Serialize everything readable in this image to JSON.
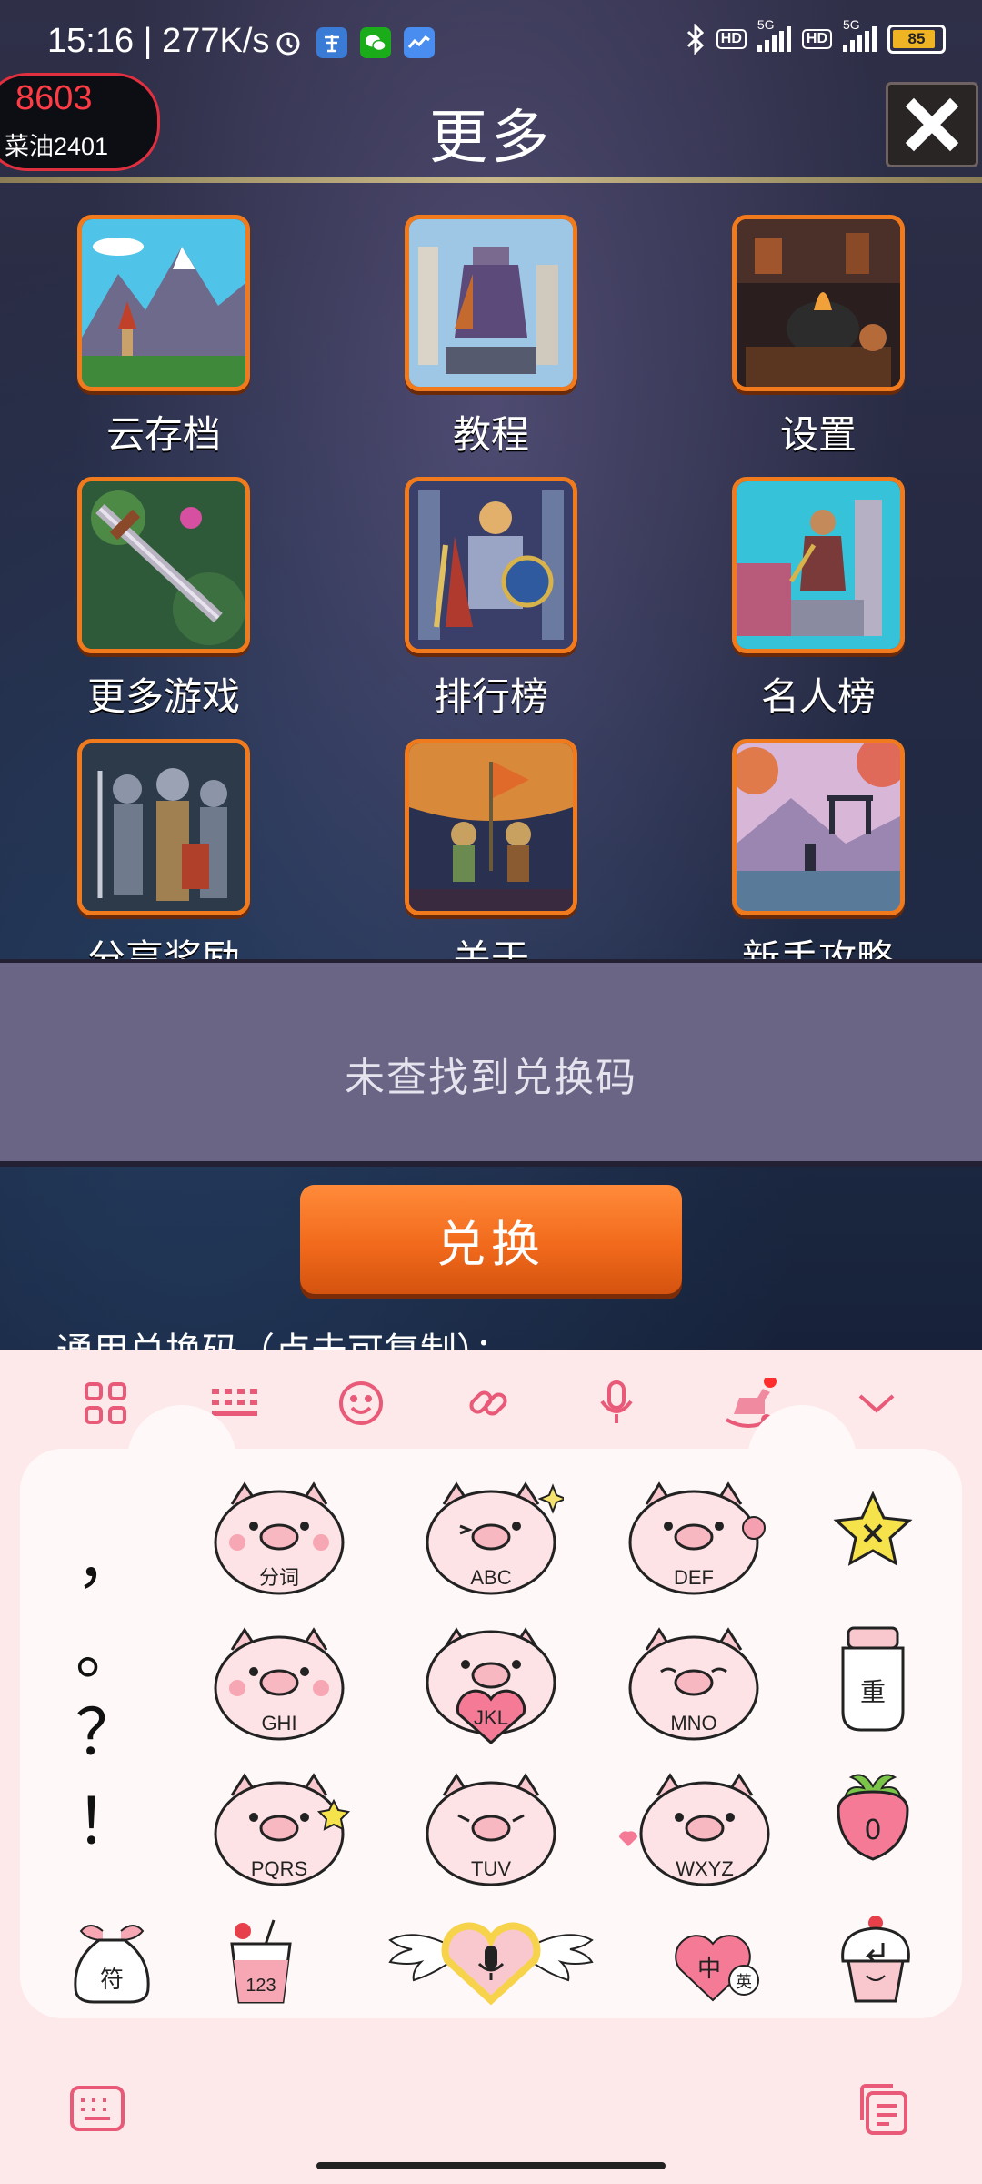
{
  "status_bar": {
    "time_speed": "15:16 | 277K/s",
    "network_1": "5G",
    "network_2": "5G",
    "hd_1": "HD",
    "hd_2": "HD",
    "battery": "85"
  },
  "header": {
    "score": "8603",
    "player_name": "菜油2401",
    "title": "更多"
  },
  "menu": {
    "items": [
      {
        "label": "云存档",
        "icon": "cloud-save-icon"
      },
      {
        "label": "教程",
        "icon": "tutorial-icon"
      },
      {
        "label": "设置",
        "icon": "settings-icon"
      },
      {
        "label": "更多游戏",
        "icon": "more-games-icon"
      },
      {
        "label": "排行榜",
        "icon": "leaderboard-icon"
      },
      {
        "label": "名人榜",
        "icon": "hall-of-fame-icon"
      },
      {
        "label": "分享奖励",
        "icon": "share-reward-icon"
      },
      {
        "label": "关于",
        "icon": "about-icon"
      },
      {
        "label": "新手攻略",
        "icon": "beginner-guide-icon"
      }
    ]
  },
  "redeem": {
    "message": "未查找到兑换码",
    "button": "兑换",
    "generic_code_label": "通用兑换码（点击可复制）："
  },
  "keyboard": {
    "punct_1": "，",
    "punct_2": "。",
    "punct_3": "？",
    "punct_4": "！",
    "keys": {
      "k1": "分词",
      "k2": "ABC",
      "k3": "DEF",
      "k4": "GHI",
      "k5": "JKL",
      "k6": "MNO",
      "k7": "PQRS",
      "k8": "TUV",
      "k9": "WXYZ"
    },
    "reset_key": "重",
    "zero_key": "0",
    "symbol_key": "符",
    "num_key": "123",
    "zh_key": "中",
    "en_key": "英",
    "accent": "#e85a78"
  }
}
